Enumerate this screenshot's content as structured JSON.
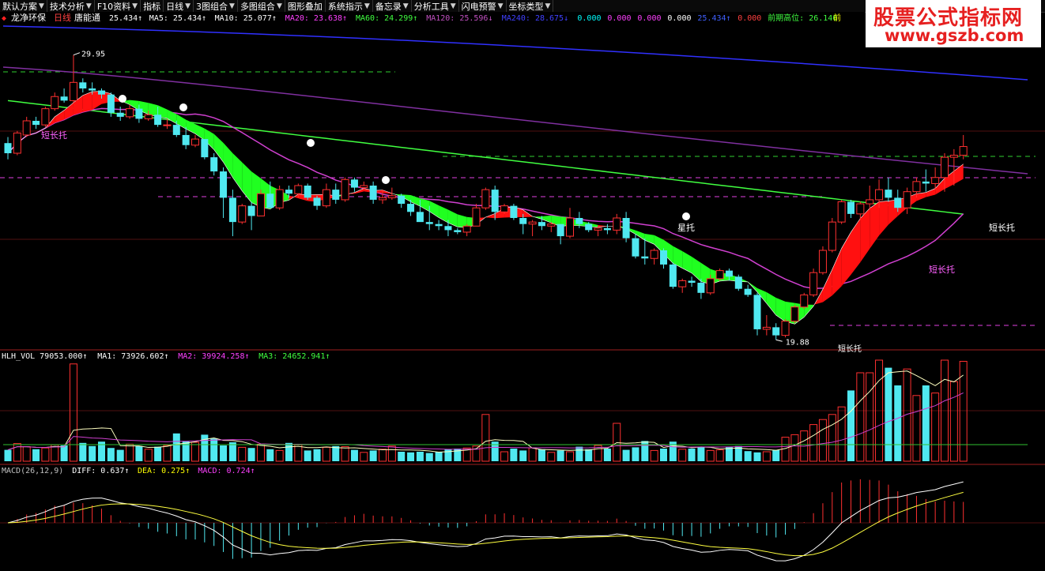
{
  "toolbar": [
    {
      "label": "默认方案",
      "arrow": true
    },
    {
      "label": "技术分析",
      "arrow": true
    },
    {
      "label": "F10资料",
      "arrow": true
    },
    {
      "label": "指标",
      "arrow": false
    },
    {
      "label": "日线",
      "arrow": true
    },
    {
      "label": "3图组合",
      "arrow": true
    },
    {
      "label": "多图组合",
      "arrow": true
    },
    {
      "label": "图形叠加",
      "arrow": false
    },
    {
      "label": "系统指示",
      "arrow": true
    },
    {
      "label": "备忘录",
      "arrow": true
    },
    {
      "label": "分析工具",
      "arrow": true
    },
    {
      "label": "闪电预警",
      "arrow": true
    },
    {
      "label": "坐标类型",
      "arrow": true
    }
  ],
  "stock": {
    "name": "龙净环保",
    "period": "日线",
    "indicator": "唐能通"
  },
  "main_header": [
    {
      "text": "25.434↑",
      "color": "#ffffff"
    },
    {
      "text": "MA5: 25.434↑",
      "color": "#ffffff"
    },
    {
      "text": "MA10: 25.077↑",
      "color": "#ffffff"
    },
    {
      "text": "MA20: 23.638↑",
      "color": "#ff40ff"
    },
    {
      "text": "MA60: 24.299↑",
      "color": "#40ff40"
    },
    {
      "text": "MA120: 25.596↓",
      "color": "#c050c0"
    },
    {
      "text": "MA240: 28.675↓",
      "color": "#4040ff"
    },
    {
      "text": "0.000",
      "color": "#00ffff"
    },
    {
      "text": "0.000",
      "color": "#ff40ff"
    },
    {
      "text": "0.000",
      "color": "#ff40ff"
    },
    {
      "text": "0.000",
      "color": "#ffffff"
    },
    {
      "text": "25.434↑",
      "color": "#4060ff"
    },
    {
      "text": "0.000",
      "color": "#ff4040"
    },
    {
      "text": "前期高位: 26.140",
      "color": "#40ff40"
    },
    {
      "text": "前",
      "color": "#ffff00"
    }
  ],
  "annotations": {
    "high_price": "29.95",
    "low_price": "19.88",
    "labels": [
      "短长托",
      "星托",
      "短长托",
      "短长托",
      "短长托"
    ]
  },
  "vol_header": [
    {
      "text": "HLH_VOL 79053.000↑",
      "color": "#ffffff"
    },
    {
      "text": "MA1: 73926.602↑",
      "color": "#ffffff"
    },
    {
      "text": "MA2: 39924.258↑",
      "color": "#ff40ff"
    },
    {
      "text": "MA3: 24652.941↑",
      "color": "#40ff40"
    }
  ],
  "macd_header": [
    {
      "text": "MACD(26,12,9)",
      "color": "#c0c0c0"
    },
    {
      "text": "DIFF: 0.637↑",
      "color": "#ffffff"
    },
    {
      "text": "DEA: 0.275↑",
      "color": "#ffff00"
    },
    {
      "text": "MACD: 0.724↑",
      "color": "#ff40ff"
    }
  ],
  "watermark": {
    "title": "股票公式指标网",
    "url": "www.gszb.com"
  },
  "colors": {
    "up": "#ff3030",
    "down": "#50e8f0",
    "ma20": "#d040d0",
    "ma60": "#40ff40",
    "ma240": "#3030ff",
    "band_up": "#ff1010",
    "band_down": "#20ff20",
    "dashed_green": "#30d030",
    "dashed_pink": "#e040e0"
  },
  "chart_data": {
    "type": "candlestick",
    "ohlc": [
      [
        25.6,
        25.9,
        24.8,
        25.1
      ],
      [
        25.1,
        26.2,
        25.0,
        26.1
      ],
      [
        26.0,
        26.9,
        25.9,
        26.7
      ],
      [
        26.7,
        26.9,
        26.3,
        26.5
      ],
      [
        26.5,
        27.4,
        26.4,
        27.3
      ],
      [
        27.3,
        28.1,
        27.2,
        27.9
      ],
      [
        27.9,
        28.3,
        27.6,
        27.7
      ],
      [
        27.7,
        29.95,
        27.6,
        28.6
      ],
      [
        28.6,
        28.8,
        28.1,
        28.3
      ],
      [
        28.3,
        28.6,
        28.0,
        28.2
      ],
      [
        28.2,
        28.3,
        27.8,
        28.0
      ],
      [
        28.0,
        28.1,
        26.9,
        27.1
      ],
      [
        27.1,
        27.4,
        26.7,
        26.9
      ],
      [
        26.9,
        27.5,
        26.8,
        27.3
      ],
      [
        27.3,
        27.5,
        26.6,
        26.8
      ],
      [
        26.8,
        27.2,
        26.7,
        27.0
      ],
      [
        27.0,
        27.4,
        26.4,
        26.5
      ],
      [
        26.5,
        26.8,
        26.3,
        26.5
      ],
      [
        26.5,
        26.7,
        25.9,
        26.0
      ],
      [
        26.0,
        26.4,
        25.3,
        25.5
      ],
      [
        25.5,
        26.0,
        25.4,
        25.8
      ],
      [
        25.8,
        25.8,
        24.8,
        24.9
      ],
      [
        24.9,
        25.1,
        24.0,
        24.2
      ],
      [
        24.2,
        24.4,
        21.9,
        22.9
      ],
      [
        22.9,
        23.3,
        21.0,
        21.7
      ],
      [
        21.7,
        22.6,
        21.6,
        22.5
      ],
      [
        22.5,
        22.7,
        21.3,
        22.0
      ],
      [
        22.0,
        23.3,
        22.0,
        23.1
      ],
      [
        23.1,
        23.7,
        22.4,
        22.4
      ],
      [
        22.4,
        23.5,
        22.3,
        23.3
      ],
      [
        23.3,
        23.5,
        22.9,
        23.1
      ],
      [
        23.1,
        23.6,
        22.9,
        23.5
      ],
      [
        23.5,
        23.6,
        22.8,
        22.9
      ],
      [
        22.9,
        23.0,
        22.3,
        22.5
      ],
      [
        22.5,
        23.6,
        22.4,
        23.3
      ],
      [
        23.3,
        23.6,
        22.6,
        22.8
      ],
      [
        22.8,
        23.9,
        22.7,
        23.8
      ],
      [
        23.8,
        23.9,
        23.2,
        23.4
      ],
      [
        23.4,
        23.7,
        23.3,
        23.5
      ],
      [
        23.5,
        23.7,
        22.6,
        22.8
      ],
      [
        22.8,
        23.3,
        22.6,
        22.9
      ],
      [
        22.9,
        23.4,
        22.8,
        23.0
      ],
      [
        23.0,
        23.1,
        22.4,
        22.6
      ],
      [
        22.6,
        22.8,
        22.0,
        22.2
      ],
      [
        22.2,
        22.8,
        21.9,
        21.7
      ],
      [
        21.7,
        22.5,
        21.3,
        21.6
      ],
      [
        21.6,
        21.8,
        21.3,
        21.5
      ],
      [
        21.5,
        21.8,
        21.0,
        21.3
      ],
      [
        21.3,
        21.4,
        21.1,
        21.2
      ],
      [
        21.2,
        21.6,
        21.0,
        21.5
      ],
      [
        21.5,
        22.6,
        21.5,
        22.4
      ],
      [
        22.4,
        23.4,
        22.3,
        23.3
      ],
      [
        23.3,
        23.5,
        21.8,
        22.2
      ],
      [
        22.2,
        22.6,
        22.1,
        22.5
      ],
      [
        22.5,
        22.6,
        21.8,
        21.9
      ],
      [
        21.9,
        22.1,
        21.1,
        21.6
      ],
      [
        21.6,
        21.8,
        21.0,
        21.7
      ],
      [
        21.7,
        22.0,
        21.3,
        21.5
      ],
      [
        21.5,
        21.7,
        21.2,
        21.6
      ],
      [
        21.6,
        21.6,
        20.6,
        21.0
      ],
      [
        21.0,
        22.4,
        20.9,
        21.9
      ],
      [
        21.9,
        22.2,
        21.4,
        21.6
      ],
      [
        21.6,
        21.7,
        21.2,
        21.3
      ],
      [
        21.3,
        21.5,
        21.0,
        21.4
      ],
      [
        21.4,
        21.6,
        21.1,
        21.3
      ],
      [
        21.3,
        22.1,
        21.1,
        21.9
      ],
      [
        21.9,
        22.2,
        20.7,
        20.9
      ],
      [
        20.9,
        21.1,
        19.9,
        20.0
      ],
      [
        20.0,
        20.9,
        19.6,
        19.9
      ],
      [
        19.9,
        20.4,
        19.6,
        20.3
      ],
      [
        20.3,
        20.4,
        19.4,
        19.6
      ],
      [
        19.6,
        19.7,
        18.4,
        18.5
      ],
      [
        18.5,
        18.9,
        18.2,
        18.8
      ],
      [
        18.8,
        19.0,
        18.5,
        18.7
      ],
      [
        18.7,
        18.9,
        17.9,
        18.2
      ],
      [
        18.2,
        19.1,
        18.1,
        18.9
      ],
      [
        18.9,
        19.4,
        18.8,
        19.3
      ],
      [
        19.3,
        19.4,
        18.8,
        19.0
      ],
      [
        19.0,
        19.1,
        18.3,
        18.4
      ],
      [
        18.4,
        18.6,
        18.0,
        18.1
      ],
      [
        18.1,
        18.2,
        16.1,
        16.4
      ],
      [
        16.4,
        17.1,
        16.1,
        16.5
      ],
      [
        16.5,
        16.7,
        15.88,
        16.1
      ],
      [
        16.1,
        16.9,
        16.0,
        16.8
      ],
      [
        16.8,
        17.6,
        16.7,
        17.5
      ],
      [
        17.5,
        18.2,
        17.4,
        18.1
      ],
      [
        18.1,
        19.4,
        18.0,
        19.2
      ],
      [
        19.2,
        20.5,
        19.1,
        20.3
      ],
      [
        20.3,
        21.9,
        20.2,
        21.7
      ],
      [
        21.7,
        22.8,
        21.6,
        22.7
      ],
      [
        22.7,
        22.8,
        21.9,
        22.1
      ],
      [
        22.1,
        22.7,
        21.8,
        22.6
      ],
      [
        22.6,
        23.5,
        22.3,
        22.8
      ],
      [
        22.8,
        23.8,
        22.4,
        23.3
      ],
      [
        23.3,
        23.9,
        22.7,
        22.9
      ],
      [
        22.9,
        23.3,
        22.2,
        22.4
      ],
      [
        22.4,
        23.4,
        22.1,
        23.2
      ],
      [
        23.2,
        23.9,
        22.9,
        23.7
      ],
      [
        23.7,
        24.3,
        23.2,
        23.6
      ],
      [
        23.6,
        24.4,
        23.3,
        23.9
      ],
      [
        23.9,
        25.1,
        23.2,
        24.9
      ],
      [
        24.9,
        25.3,
        23.5,
        25.0
      ],
      [
        25.0,
        26.0,
        24.8,
        25.43
      ]
    ],
    "volume": [
      9000,
      14000,
      11500,
      9500,
      10500,
      13000,
      12500,
      77000,
      14500,
      12000,
      15500,
      10500,
      9000,
      13500,
      12000,
      9500,
      11500,
      12500,
      22000,
      16000,
      15000,
      21000,
      18000,
      12500,
      15000,
      11000,
      10500,
      13500,
      9500,
      8500,
      14500,
      13000,
      8500,
      9500,
      11000,
      12000,
      11500,
      9000,
      7000,
      8500,
      9500,
      12000,
      7500,
      7000,
      7500,
      6500,
      7500,
      9500,
      10000,
      10500,
      12000,
      37000,
      15500,
      7500,
      10000,
      8500,
      10500,
      9500,
      7000,
      8500,
      7500,
      11500,
      9500,
      12500,
      10000,
      30000,
      9000,
      11000,
      16000,
      8500,
      10000,
      15500,
      9500,
      10000,
      11500,
      8500,
      9000,
      11500,
      12000,
      8000,
      7000,
      7500,
      9000,
      19000,
      21000,
      24000,
      29000,
      33000,
      37000,
      43000,
      56000,
      70000,
      70000,
      80000,
      74000,
      60000,
      73000,
      52000,
      60000,
      54000,
      85000,
      63000,
      79053
    ]
  }
}
